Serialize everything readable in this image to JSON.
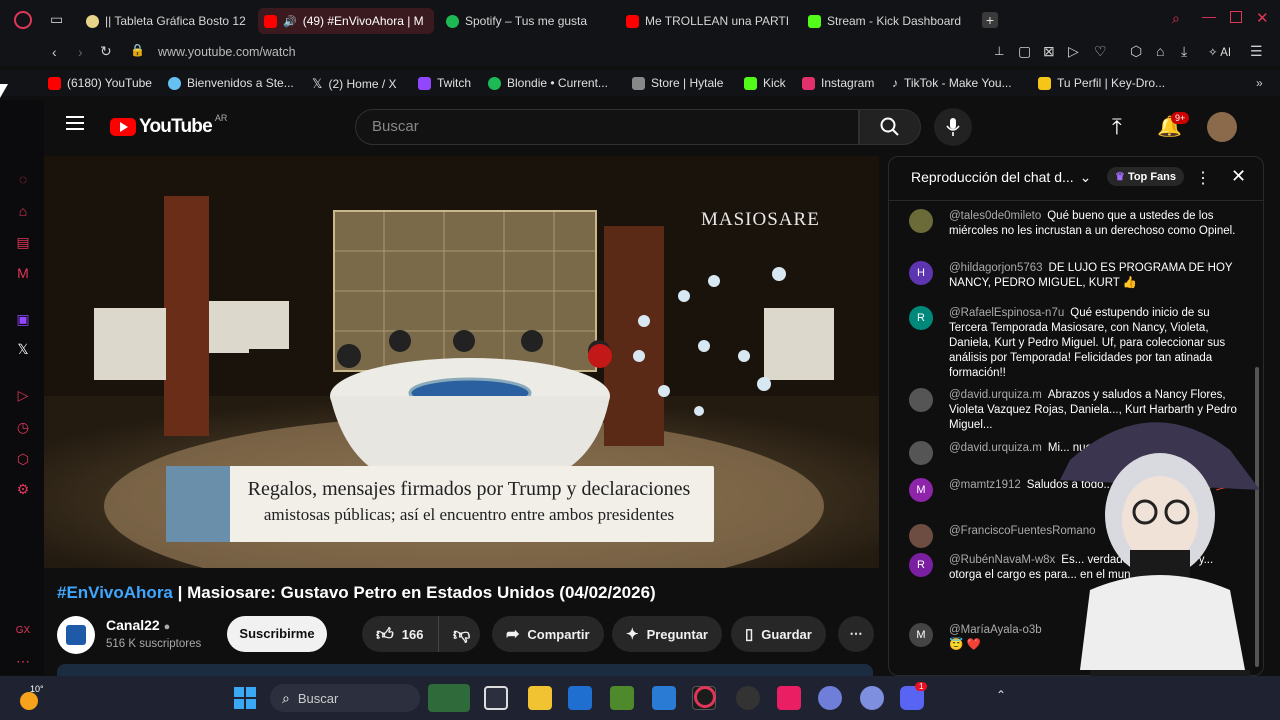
{
  "browser": {
    "tabs": [
      {
        "label": "|| Tableta Gráfica Bosto 12",
        "color": "#e8d38a"
      },
      {
        "label": "(49) #EnVivoAhora | M",
        "color": "#ff0000"
      },
      {
        "label": "Spotify – Tus me gusta",
        "color": "#1db954"
      },
      {
        "label": "Me TROLLEAN una PARTIE",
        "color": "#ff0000"
      },
      {
        "label": "Stream - Kick Dashboard",
        "color": "#53fc18"
      }
    ],
    "url": "www.youtube.com/watch",
    "ai_label": "AI",
    "bookmarks": [
      {
        "label": "(6180) YouTube",
        "color": "#ff0000"
      },
      {
        "label": "Bienvenidos a Ste...",
        "color": "#66c0f4"
      },
      {
        "label": "(2) Home / X",
        "color": "#ffffff"
      },
      {
        "label": "Twitch",
        "color": "#9146ff"
      },
      {
        "label": "Blondie • Current...",
        "color": "#1db954"
      },
      {
        "label": "Store | Hytale",
        "color": "#cccccc"
      },
      {
        "label": "Kick",
        "color": "#53fc18"
      },
      {
        "label": "Instagram",
        "color": "#e1306c"
      },
      {
        "label": "TikTok - Make You...",
        "color": "#ffffff"
      },
      {
        "label": "Tu Perfil | Key-Dro...",
        "color": "#f5c518"
      }
    ]
  },
  "youtube": {
    "logo_text": "YouTube",
    "region": "AR",
    "search_placeholder": "Buscar",
    "notif_count": "9+",
    "video": {
      "watermark": "MASIOSARE",
      "caption_line1": "Regalos, mensajes firmados por Trump y declaraciones",
      "caption_line2": "amistosas públicas; así el encuentro entre ambos presidentes"
    },
    "title_tag": "#EnVivoAhora",
    "title_rest": " | Masiosare: Gustavo Petro en Estados Unidos (04/02/2026)",
    "channel": {
      "name": "Canal22",
      "subs": "516 K suscriptores"
    },
    "subscribe_label": "Suscribirme",
    "likes": "166",
    "share_label": "Compartir",
    "ask_label": "Preguntar",
    "save_label": "Guardar"
  },
  "chat": {
    "title": "Reproducción del chat d...",
    "top_fans": "Top Fans",
    "messages": [
      {
        "user": "@tales0de0mileto",
        "text": "Qué bueno que a ustedes de los miércoles no les incrustan a un derechoso como Opinel.",
        "avatar": "",
        "color": "#6b6b3a"
      },
      {
        "user": "@hildagorjon5763",
        "text": "DE LUJO ES PROGRAMA DE HOY NANCY, PEDRO MIGUEL, KURT 👍",
        "avatar": "H",
        "color": "#5e35b1"
      },
      {
        "user": "@RafaelEspinosa-n7u",
        "text": "Qué estupendo inicio de su Tercera Temporada Masiosare, con Nancy, Violeta, Daniela, Kurt y Pedro Miguel. Uf, para coleccionar sus análisis por Temporada! Felicidades por tan atinada formación!!",
        "avatar": "R",
        "color": "#00897b"
      },
      {
        "user": "@david.urquiza.m",
        "text": "Abrazos y saludos a Nancy Flores, Violeta Vazquez Rojas, Daniela..., Kurt Harbarth y Pedro Miguel...",
        "avatar": "",
        "color": "#555"
      },
      {
        "user": "@david.urquiza.m",
        "text": "Mi... nueva Temporada.",
        "avatar": "",
        "color": "#555"
      },
      {
        "user": "@mamtz1912",
        "text": "Saludos a todo... Nacy Flores ❤️ 👍 💯",
        "avatar": "M",
        "color": "#8e24aa"
      },
      {
        "user": "@FranciscoFuentesRomano",
        "text": "",
        "avatar": "",
        "color": "#6d4c41"
      },
      {
        "user": "@RubénNavaM-w8x",
        "text": "Es... verdaderamente loco y... otorga el cargo es para... en el mundo!!!!",
        "avatar": "R",
        "color": "#7b1fa2"
      },
      {
        "user": "@MaríaAyala-o3b",
        "text": "😇 ❤️",
        "avatar": "M",
        "color": "#444"
      }
    ]
  },
  "taskbar": {
    "weather": "10°",
    "search_placeholder": "Buscar",
    "badge": "1"
  }
}
